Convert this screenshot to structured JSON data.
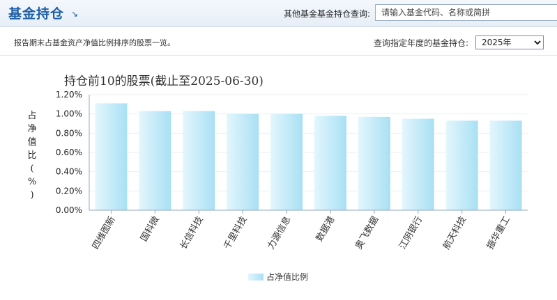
{
  "header": {
    "title": "基金持仓",
    "title_icon": "↘",
    "search_label": "其他基金基金持仓查询:",
    "search_placeholder": "请输入基金代码、名称或简拼"
  },
  "subbar": {
    "description": "报告期末占基金资产净值比例排序的股票一览。",
    "year_label": "查询指定年度的基金持仓:",
    "year_selected": "2025年"
  },
  "colors": {
    "bar_top": "#c9ecf8",
    "bar_bottom": "#a9e0f4",
    "accent": "#1f5fa8"
  },
  "chart_data": {
    "type": "bar",
    "title": "持仓前10的股票(截止至2025-06-30)",
    "ylabel": "占净值比(%)",
    "xlabel": "",
    "categories": [
      "四维图新",
      "国科微",
      "长信科技",
      "千里科技",
      "力源信息",
      "数据港",
      "奥飞数据",
      "江阴银行",
      "航天科技",
      "振华重工"
    ],
    "series": [
      {
        "name": "占净值比例",
        "values": [
          1.11,
          1.03,
          1.03,
          1.0,
          1.0,
          0.98,
          0.97,
          0.95,
          0.93,
          0.93
        ]
      }
    ],
    "ylim": [
      0,
      1.2
    ],
    "yticks": [
      "0.00%",
      "0.20%",
      "0.40%",
      "0.60%",
      "0.80%",
      "1.00%",
      "1.20%"
    ],
    "grid": true,
    "legend_position": "bottom"
  }
}
